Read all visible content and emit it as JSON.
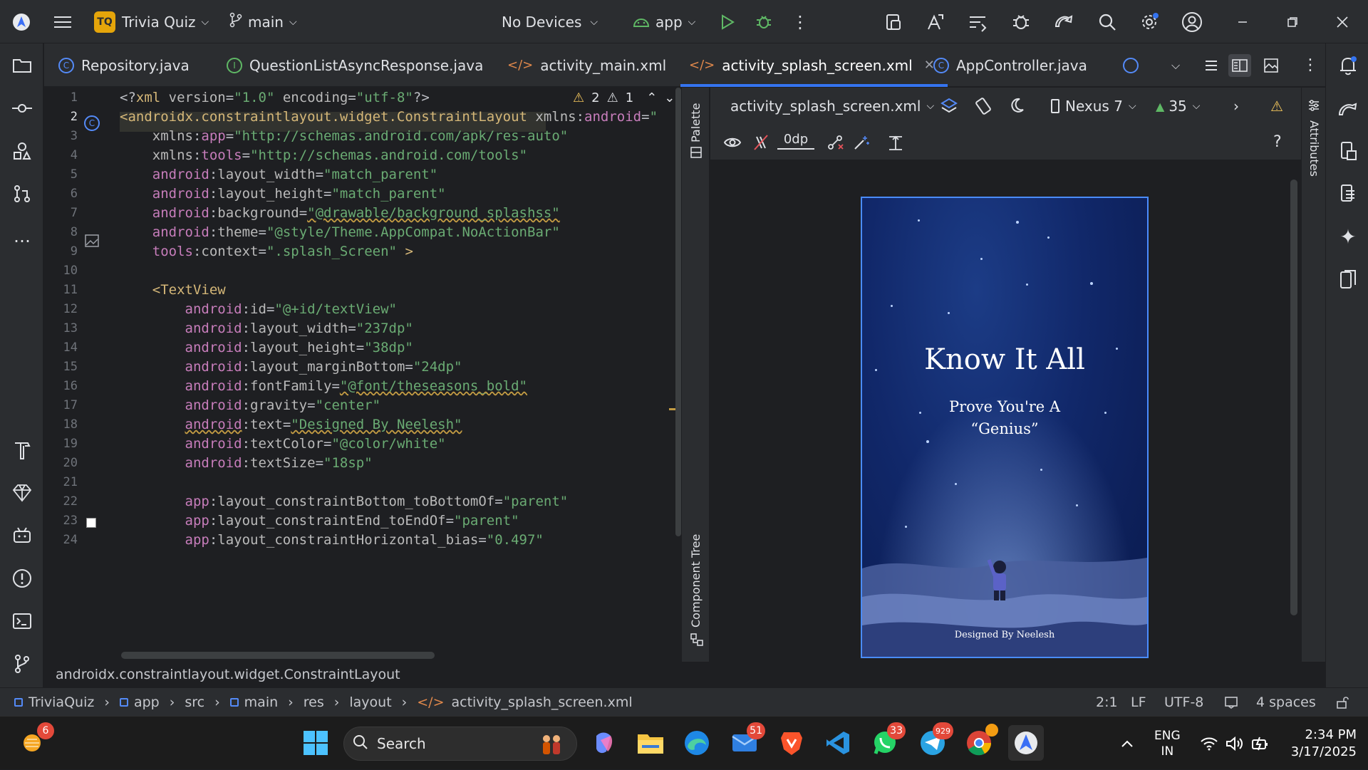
{
  "titlebar": {
    "project_badge": "TQ",
    "project": "Trivia Quiz",
    "branch": "main",
    "device": "No Devices",
    "run_config": "app"
  },
  "tabs": [
    {
      "label": "Repository.java",
      "icon": "C"
    },
    {
      "label": "QuestionListAsyncResponse.java",
      "icon": "I"
    },
    {
      "label": "activity_main.xml",
      "icon": "</>"
    },
    {
      "label": "activity_splash_screen.xml",
      "icon": "</>"
    },
    {
      "label": "AppController.java",
      "icon": "C"
    }
  ],
  "editor": {
    "warnings": "2",
    "weak_warnings": "1",
    "line_numbers": [
      "1",
      "2",
      "3",
      "4",
      "5",
      "6",
      "7",
      "8",
      "9",
      "10",
      "11",
      "12",
      "13",
      "14",
      "15",
      "16",
      "17",
      "18",
      "19",
      "20",
      "21",
      "22",
      "23",
      "24"
    ],
    "lines": [
      [
        [
          "p",
          "<?"
        ],
        [
          "t",
          "xml "
        ],
        [
          "a",
          "version"
        ],
        [
          "p",
          "="
        ],
        [
          "v",
          "\"1.0\""
        ],
        [
          "a",
          " encoding"
        ],
        [
          "p",
          "="
        ],
        [
          "v",
          "\"utf-8\""
        ],
        [
          "p",
          "?>"
        ]
      ],
      [
        [
          "t",
          "<androidx.constraintlayout.widget.ConstraintLayout"
        ],
        [
          "a",
          " xmlns"
        ],
        [
          "p",
          ":"
        ],
        [
          "n",
          "android"
        ],
        [
          "p",
          "="
        ],
        [
          "v",
          "\""
        ]
      ],
      [
        [
          "p",
          "    "
        ],
        [
          "a",
          "xmlns"
        ],
        [
          "p",
          ":"
        ],
        [
          "n",
          "app"
        ],
        [
          "p",
          "="
        ],
        [
          "v",
          "\"http://schemas.android.com/apk/res-auto\""
        ]
      ],
      [
        [
          "p",
          "    "
        ],
        [
          "a",
          "xmlns"
        ],
        [
          "p",
          ":"
        ],
        [
          "n",
          "tools"
        ],
        [
          "p",
          "="
        ],
        [
          "v",
          "\"http://schemas.android.com/tools\""
        ]
      ],
      [
        [
          "p",
          "    "
        ],
        [
          "n",
          "android"
        ],
        [
          "p",
          ":"
        ],
        [
          "a",
          "layout_width"
        ],
        [
          "p",
          "="
        ],
        [
          "v",
          "\"match_parent\""
        ]
      ],
      [
        [
          "p",
          "    "
        ],
        [
          "n",
          "android"
        ],
        [
          "p",
          ":"
        ],
        [
          "a",
          "layout_height"
        ],
        [
          "p",
          "="
        ],
        [
          "v",
          "\"match_parent\""
        ]
      ],
      [
        [
          "p",
          "    "
        ],
        [
          "n",
          "android"
        ],
        [
          "p",
          ":"
        ],
        [
          "a",
          "background"
        ],
        [
          "p",
          "="
        ],
        [
          "v",
          "\"@drawable/background_splashss\""
        ]
      ],
      [
        [
          "p",
          "    "
        ],
        [
          "n",
          "android"
        ],
        [
          "p",
          ":"
        ],
        [
          "a",
          "theme"
        ],
        [
          "p",
          "="
        ],
        [
          "v",
          "\"@style/Theme.AppCompat.NoActionBar\""
        ]
      ],
      [
        [
          "p",
          "    "
        ],
        [
          "n",
          "tools"
        ],
        [
          "p",
          ":"
        ],
        [
          "a",
          "context"
        ],
        [
          "p",
          "="
        ],
        [
          "v",
          "\".splash_Screen\""
        ],
        [
          "p",
          " "
        ],
        [
          "t",
          ">"
        ]
      ],
      [
        [
          "p",
          ""
        ]
      ],
      [
        [
          "p",
          "    "
        ],
        [
          "t",
          "<TextView"
        ]
      ],
      [
        [
          "p",
          "        "
        ],
        [
          "n",
          "android"
        ],
        [
          "p",
          ":"
        ],
        [
          "a",
          "id"
        ],
        [
          "p",
          "="
        ],
        [
          "v",
          "\"@+id/textView\""
        ]
      ],
      [
        [
          "p",
          "        "
        ],
        [
          "n",
          "android"
        ],
        [
          "p",
          ":"
        ],
        [
          "a",
          "layout_width"
        ],
        [
          "p",
          "="
        ],
        [
          "v",
          "\"237dp\""
        ]
      ],
      [
        [
          "p",
          "        "
        ],
        [
          "n",
          "android"
        ],
        [
          "p",
          ":"
        ],
        [
          "a",
          "layout_height"
        ],
        [
          "p",
          "="
        ],
        [
          "v",
          "\"38dp\""
        ]
      ],
      [
        [
          "p",
          "        "
        ],
        [
          "n",
          "android"
        ],
        [
          "p",
          ":"
        ],
        [
          "a",
          "layout_marginBottom"
        ],
        [
          "p",
          "="
        ],
        [
          "v",
          "\"24dp\""
        ]
      ],
      [
        [
          "p",
          "        "
        ],
        [
          "n",
          "android"
        ],
        [
          "p",
          ":"
        ],
        [
          "a",
          "fontFamily"
        ],
        [
          "p",
          "="
        ],
        [
          "v",
          "\"@font/theseasons_bold\""
        ]
      ],
      [
        [
          "p",
          "        "
        ],
        [
          "n",
          "android"
        ],
        [
          "p",
          ":"
        ],
        [
          "a",
          "gravity"
        ],
        [
          "p",
          "="
        ],
        [
          "v",
          "\"center\""
        ]
      ],
      [
        [
          "p",
          "        "
        ],
        [
          "n",
          "android"
        ],
        [
          "p",
          ":"
        ],
        [
          "a",
          "text"
        ],
        [
          "p",
          "="
        ],
        [
          "v",
          "\"Designed By Neelesh\""
        ]
      ],
      [
        [
          "p",
          "        "
        ],
        [
          "n",
          "android"
        ],
        [
          "p",
          ":"
        ],
        [
          "a",
          "textColor"
        ],
        [
          "p",
          "="
        ],
        [
          "v",
          "\"@color/white\""
        ]
      ],
      [
        [
          "p",
          "        "
        ],
        [
          "n",
          "android"
        ],
        [
          "p",
          ":"
        ],
        [
          "a",
          "textSize"
        ],
        [
          "p",
          "="
        ],
        [
          "v",
          "\"18sp\""
        ]
      ],
      [
        [
          "p",
          ""
        ]
      ],
      [
        [
          "p",
          "        "
        ],
        [
          "n",
          "app"
        ],
        [
          "p",
          ":"
        ],
        [
          "a",
          "layout_constraintBottom_toBottomOf"
        ],
        [
          "p",
          "="
        ],
        [
          "v",
          "\"parent\""
        ]
      ],
      [
        [
          "p",
          "        "
        ],
        [
          "n",
          "app"
        ],
        [
          "p",
          ":"
        ],
        [
          "a",
          "layout_constraintEnd_toEndOf"
        ],
        [
          "p",
          "="
        ],
        [
          "v",
          "\"parent\""
        ]
      ],
      [
        [
          "p",
          "        "
        ],
        [
          "n",
          "app"
        ],
        [
          "p",
          ":"
        ],
        [
          "a",
          "layout_constraintHorizontal_bias"
        ],
        [
          "p",
          "="
        ],
        [
          "v",
          "\"0.497\""
        ]
      ]
    ]
  },
  "palette_label": "Palette",
  "component_tree_label": "Component Tree",
  "attributes_label": "Attributes",
  "designer": {
    "file": "activity_splash_screen.xml",
    "device": "Nexus 7",
    "api": "35",
    "margin": "0dp",
    "preview_title": "Know It All",
    "preview_sub1": "Prove You're A",
    "preview_sub2": "“Genius”",
    "preview_credit": "Designed By Neelesh"
  },
  "status": {
    "element": "androidx.constraintlayout.widget.ConstraintLayout"
  },
  "breadcrumb": {
    "items": [
      "TriviaQuiz",
      "app",
      "src",
      "main",
      "res",
      "layout",
      "activity_splash_screen.xml"
    ],
    "position": "2:1",
    "line_sep": "LF",
    "encoding": "UTF-8",
    "indent": "4 spaces"
  },
  "taskbar": {
    "weather_badge": "6",
    "search_placeholder": "Search",
    "mail_badge": "51",
    "whatsapp_badge": "33",
    "telegram_badge": "929",
    "lang": "ENG",
    "region": "IN",
    "time": "2:34 PM",
    "date": "3/17/2025"
  },
  "colors": {
    "accent": "#3574f0",
    "ide_bg": "#1e1f22",
    "panel_bg": "#2b2d30",
    "xml_tag": "#d5b778",
    "xml_value": "#6aab73",
    "xml_namespace": "#c77dbb"
  }
}
